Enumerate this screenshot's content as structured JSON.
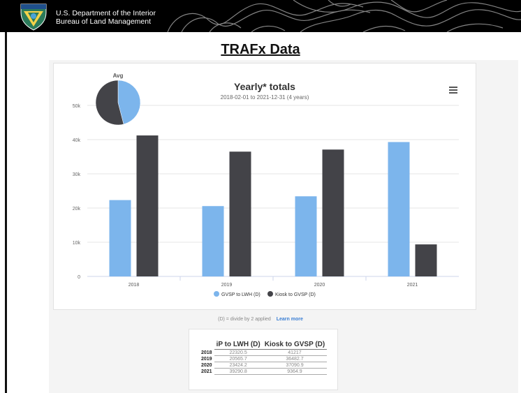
{
  "header": {
    "agency_line1": "U.S. Department of the Interior",
    "agency_line2": "Bureau of Land Management"
  },
  "page_title": "TRAFx Data",
  "chart_data": {
    "type": "bar",
    "title": "Yearly* totals",
    "subtitle": "2018-02-01 to 2021-12-31 (4 years)",
    "categories": [
      "2018",
      "2019",
      "2020",
      "2021"
    ],
    "series": [
      {
        "name": "GVSP to LWH (D)",
        "color": "#7cb5ec",
        "values": [
          22320.5,
          20565.7,
          23424.2,
          39290.8
        ]
      },
      {
        "name": "Kiosk to GVSP (D)",
        "color": "#434348",
        "values": [
          41217,
          36482.7,
          37090.9,
          9364.9
        ]
      }
    ],
    "ylim": [
      0,
      50000
    ],
    "yticks": [
      "0",
      "10k",
      "20k",
      "30k",
      "40k",
      "50k"
    ],
    "grid": true,
    "legend": "bottom-center",
    "inset": {
      "type": "pie",
      "title": "Avg"
    }
  },
  "footnote": {
    "text": "(D) = divide by 2 applied",
    "link": "Learn more"
  },
  "table": {
    "headers": [
      "iP to LWH (D)",
      "Kiosk to GVSP (D)"
    ],
    "rows": [
      {
        "year": "2018",
        "a": "22320.5",
        "b": "41217"
      },
      {
        "year": "2019",
        "a": "20565.7",
        "b": "36482.7"
      },
      {
        "year": "2020",
        "a": "23424.2",
        "b": "37090.9"
      },
      {
        "year": "2021",
        "a": "39290.8",
        "b": "9364.9"
      }
    ]
  }
}
